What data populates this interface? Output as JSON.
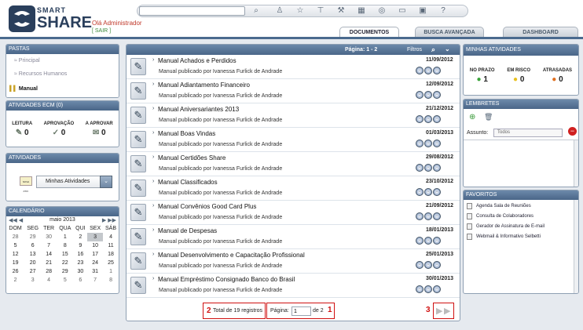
{
  "header": {
    "brand_top": "SMART",
    "brand_bottom": "SHARE",
    "greeting": "Olá Administrador",
    "logout": "[ SAIR ]",
    "search_value": ""
  },
  "toolbar_icons": [
    "search-icon",
    "people-icon",
    "star-icon",
    "filter-icon",
    "tools-icon",
    "calculator-icon",
    "help-round-icon",
    "chat-icon",
    "calendar-icon",
    "question-icon"
  ],
  "tabs": [
    {
      "label": "DOCUMENTOS",
      "active": true
    },
    {
      "label": "BUSCA AVANÇADA",
      "active": false
    },
    {
      "label": "DASHBOARD",
      "active": false
    }
  ],
  "pastas": {
    "title": "PASTAS",
    "items": [
      {
        "label": "Principal"
      },
      {
        "label": "Recursos Humanos"
      },
      {
        "label": "Manual",
        "selected": true
      }
    ]
  },
  "atividades_ecm": {
    "title": "ATIVIDADES ECM (0)",
    "cols": [
      {
        "label": "LEITURA",
        "count": "0"
      },
      {
        "label": "APROVAÇÃO",
        "count": "0"
      },
      {
        "label": "A APROVAR",
        "count": "0"
      }
    ]
  },
  "atividades": {
    "title": "ATIVIDADES",
    "select_label": "Minhas Atividades",
    "new_badge": "NOVA ATIV."
  },
  "calendario": {
    "title": "CALENDÁRIO",
    "prev": "◀◀  ◀",
    "next": "▶  ▶▶",
    "month": "maio 2013",
    "days": [
      "DOM",
      "SEG",
      "TER",
      "QUA",
      "QUI",
      "SEX",
      "SÁB"
    ],
    "weeks": [
      [
        "28",
        "29",
        "30",
        "1",
        "2",
        "3",
        "4"
      ],
      [
        "5",
        "6",
        "7",
        "8",
        "9",
        "10",
        "11"
      ],
      [
        "12",
        "13",
        "14",
        "15",
        "16",
        "17",
        "18"
      ],
      [
        "19",
        "20",
        "21",
        "22",
        "23",
        "24",
        "25"
      ],
      [
        "26",
        "27",
        "28",
        "29",
        "30",
        "31",
        "1"
      ],
      [
        "2",
        "3",
        "4",
        "5",
        "6",
        "7",
        "8"
      ]
    ]
  },
  "list": {
    "page_label": "Página:  1 - 2",
    "filters": "Filtros",
    "items": [
      {
        "title": "Manual Achados e Perdidos",
        "sub": "Manual publicado por Ivanessa Furlick de Andrade",
        "date": "11/09/2012"
      },
      {
        "title": "Manual Adiantamento Financeiro",
        "sub": "Manual publicado por Ivanessa Furlick de Andrade",
        "date": "12/09/2012"
      },
      {
        "title": "Manual Aniversariantes 2013",
        "sub": "Manual publicado por Ivanessa Furlick de Andrade",
        "date": "21/12/2012"
      },
      {
        "title": "Manual Boas Vindas",
        "sub": "Manual publicado por Ivanessa Furlick de Andrade",
        "date": "01/03/2013"
      },
      {
        "title": "Manual Certidões Share",
        "sub": "Manual publicado por Ivanessa Furlick de Andrade",
        "date": "29/08/2012"
      },
      {
        "title": "Manual Classificados",
        "sub": "Manual publicado por Ivanessa Furlick de Andrade",
        "date": "23/10/2012"
      },
      {
        "title": "Manual Convênios Good Card Plus",
        "sub": "Manual publicado por Ivanessa Furlick de Andrade",
        "date": "21/09/2012"
      },
      {
        "title": "Manual de Despesas",
        "sub": "Manual publicado por Ivanessa Furlick de Andrade",
        "date": "18/01/2013"
      },
      {
        "title": "Manual Desenvolvimento e Capacitação Profissional",
        "sub": "Manual publicado por Ivanessa Furlick de Andrade",
        "date": "25/01/2013"
      },
      {
        "title": "Manual Empréstimo Consignado Banco do Brasil",
        "sub": "Manual publicado por Ivanessa Furlick de Andrade",
        "date": "30/01/2013"
      }
    ],
    "footer": {
      "total": "Total de 19 registros",
      "pagina": "Página:",
      "page_value": "1",
      "de": "de 2",
      "mark1": "1",
      "mark2": "2",
      "mark3": "3"
    }
  },
  "minhas_atividades": {
    "title": "MINHAS ATIVIDADES",
    "cols": [
      {
        "label": "NO PRAZO",
        "count": "1",
        "color": "#3aa33a"
      },
      {
        "label": "EM RISCO",
        "count": "0",
        "color": "#e8c020"
      },
      {
        "label": "ATRASADAS",
        "count": "0",
        "color": "#e07020"
      }
    ]
  },
  "lembretes": {
    "title": "LEMBRETES",
    "assunto_label": "Assunto:",
    "assunto_value": "Todos"
  },
  "favoritos": {
    "title": "FAVORITOS",
    "items": [
      "Agenda Sala de Reuniões",
      "Consulta de Colaboradores",
      "Gerador de Assinatura de E-mail",
      "Webmail & Informativo Selbetti"
    ]
  }
}
